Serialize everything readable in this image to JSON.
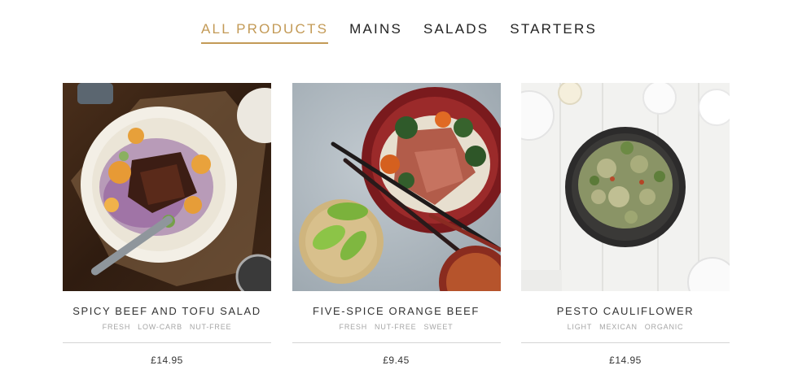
{
  "nav": {
    "tabs": [
      {
        "label": "ALL PRODUCTS"
      },
      {
        "label": "MAINS"
      },
      {
        "label": "SALADS"
      },
      {
        "label": "STARTERS"
      }
    ]
  },
  "products": [
    {
      "name": "SPICY BEEF AND TOFU SALAD",
      "tags": [
        "FRESH",
        "LOW-CARB",
        "NUT-FREE"
      ],
      "price": "£14.95"
    },
    {
      "name": "FIVE-SPICE ORANGE BEEF",
      "tags": [
        "FRESH",
        "NUT-FREE",
        "SWEET"
      ],
      "price": "£9.45"
    },
    {
      "name": "PESTO CAULIFLOWER",
      "tags": [
        "LIGHT",
        "MEXICAN",
        "ORGANIC"
      ],
      "price": "£14.95"
    }
  ],
  "colors": {
    "accent": "#c39a56",
    "text": "#333333",
    "muted": "#a6a6a6"
  }
}
